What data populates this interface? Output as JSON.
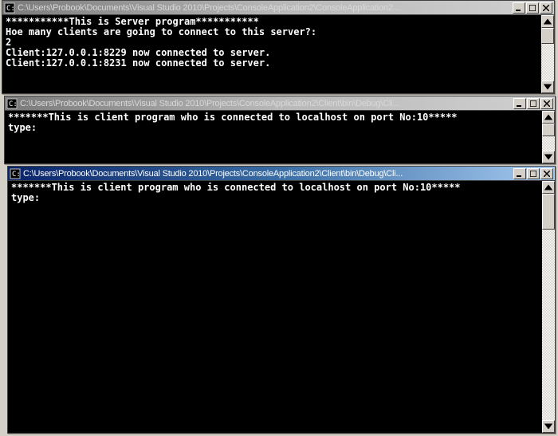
{
  "windows": {
    "server": {
      "title": "C:\\Users\\Probook\\Documents\\Visual Studio 2010\\Projects\\ConsoleApplication2\\ConsoleApplication2...",
      "lines": [
        "***********This is Server program***********",
        "Hoe many clients are going to connect to this server?:",
        "2",
        "Client:127.0.0.1:8229 now connected to server.",
        "Client:127.0.0.1:8231 now connected to server."
      ]
    },
    "client1": {
      "title": "C:\\Users\\Probook\\Documents\\Visual Studio 2010\\Projects\\ConsoleApplication2\\Client\\bin\\Debug\\Cli...",
      "lines": [
        "*******This is client program who is connected to localhost on port No:10*****",
        "type:"
      ]
    },
    "client2": {
      "title": "C:\\Users\\Probook\\Documents\\Visual Studio 2010\\Projects\\ConsoleApplication2\\Client\\bin\\Debug\\Cli...",
      "lines": [
        "*******This is client program who is connected to localhost on port No:10*****",
        "type:"
      ]
    }
  },
  "buttons": {
    "minimize": "_",
    "maximize": "□",
    "close": "✕"
  }
}
